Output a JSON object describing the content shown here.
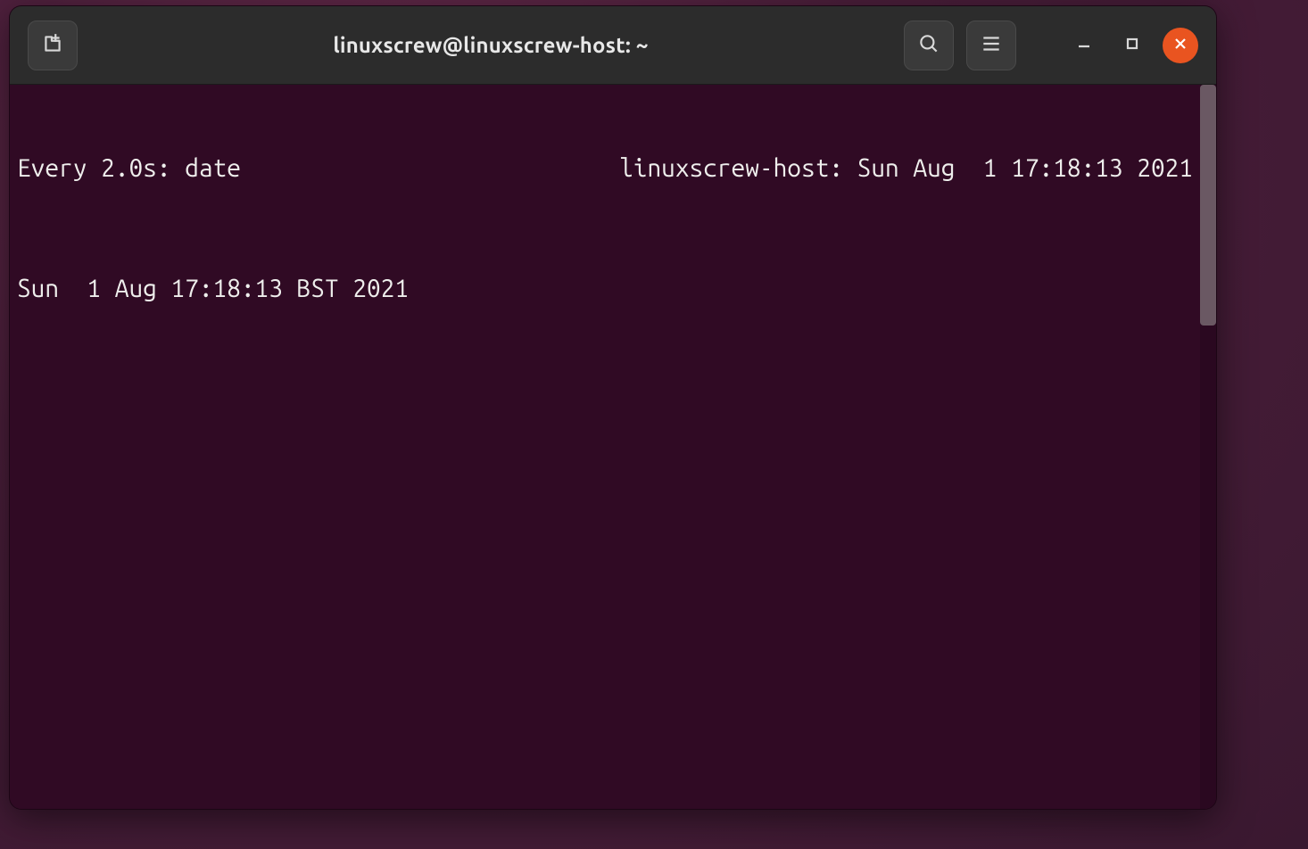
{
  "window": {
    "title": "linuxscrew@linuxscrew-host: ~"
  },
  "terminal": {
    "watch_header_left": "Every 2.0s: date",
    "watch_header_right": "linuxscrew-host: Sun Aug  1 17:18:13 2021",
    "output": "Sun  1 Aug 17:18:13 BST 2021"
  },
  "colors": {
    "titlebar_bg": "#2c2c2c",
    "terminal_bg": "#300a24",
    "close_btn": "#e95420",
    "text": "#eeeeec"
  }
}
